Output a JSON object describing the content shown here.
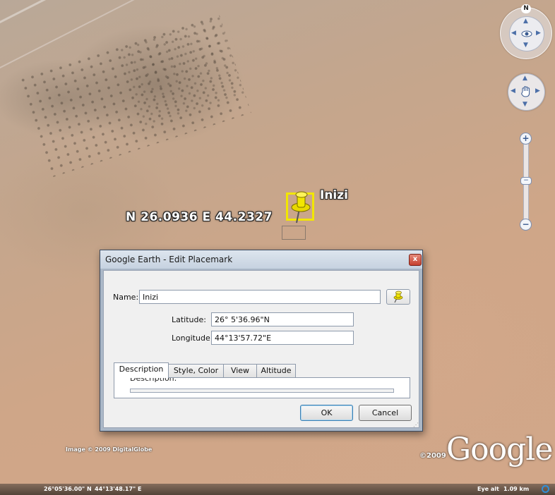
{
  "map": {
    "coord_label": "N 26.0936 E 44.2327",
    "placemark_label": "Inizi"
  },
  "navigation": {
    "north_label": "N",
    "zoom_in": "+",
    "zoom_out": "−",
    "zoom_slider": "−"
  },
  "dialog": {
    "title": "Google Earth - Edit Placemark",
    "close": "x",
    "name_label": "Name:",
    "name_value": "Inizi",
    "latitude_label": "Latitude:",
    "latitude_value": "26° 5'36.96\"N",
    "longitude_label": "Longitude:",
    "longitude_value": "44°13'57.72\"E",
    "tabs": [
      "Description",
      "Style, Color",
      "View",
      "Altitude"
    ],
    "description_peek": "Description:",
    "ok_label": "OK",
    "cancel_label": "Cancel"
  },
  "footer": {
    "imagery": "Image © 2009 DigitalGlobe",
    "copyright": "©2009",
    "logo": "Google"
  },
  "status": {
    "latitude": "26°05'36.00\" N",
    "longitude": "44°13'48.17\" E",
    "eye_alt_label": "Eye alt",
    "eye_alt_value": "1.09 km"
  },
  "colors": {
    "placemark_yellow": "#f2e600",
    "nav_blue": "#4c6fa8"
  }
}
